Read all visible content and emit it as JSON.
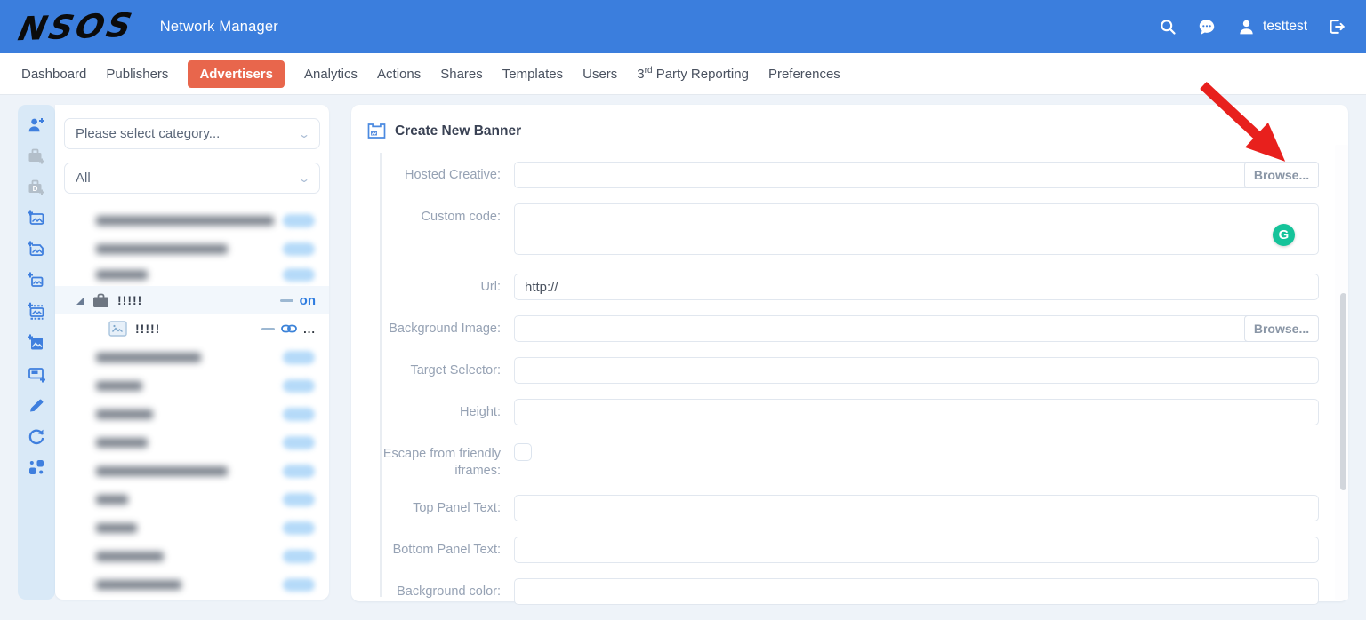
{
  "topbar": {
    "logo": "NSOS",
    "app_title": "Network Manager",
    "username": "testtest"
  },
  "nav": {
    "tabs": [
      {
        "label": "Dashboard"
      },
      {
        "label": "Publishers"
      },
      {
        "label": "Advertisers",
        "active": true
      },
      {
        "label": "Analytics"
      },
      {
        "label": "Actions"
      },
      {
        "label": "Shares"
      },
      {
        "label": "Templates"
      },
      {
        "label": "Users"
      },
      {
        "label_prefix": "3",
        "label_sup": "rd",
        "label_rest": " Party Reporting"
      },
      {
        "label": "Preferences"
      }
    ]
  },
  "sidebar": {
    "category_select": {
      "value": "Please select category..."
    },
    "filter_select": {
      "value": "All"
    },
    "tree": {
      "parent_item": {
        "label": "!!!!!",
        "status": "on"
      },
      "child_item": {
        "label": "!!!!!",
        "suffix": "..."
      }
    }
  },
  "main": {
    "panel_title": "Create New Banner",
    "fields": [
      {
        "label": "Hosted Creative:",
        "button": "Browse..."
      },
      {
        "label": "Custom code:"
      },
      {
        "label": "Url:",
        "value": "http://"
      },
      {
        "label": "Background Image:",
        "button": "Browse..."
      },
      {
        "label": "Target Selector:"
      },
      {
        "label": "Height:"
      },
      {
        "label": "Escape from friendly iframes:"
      },
      {
        "label": "Top Panel Text:"
      },
      {
        "label": "Bottom Panel Text:"
      },
      {
        "label": "Background color:"
      }
    ],
    "grammarly_letter": "G"
  },
  "colors": {
    "header_blue": "#3b7edd",
    "active_tab_orange": "#e8664c",
    "accent_blue": "#3f7fde",
    "grammarly_green": "#15c39a",
    "arrow_red": "#e8201d",
    "rail_bg": "#d9e9f7",
    "page_bg": "#eef3f9"
  }
}
